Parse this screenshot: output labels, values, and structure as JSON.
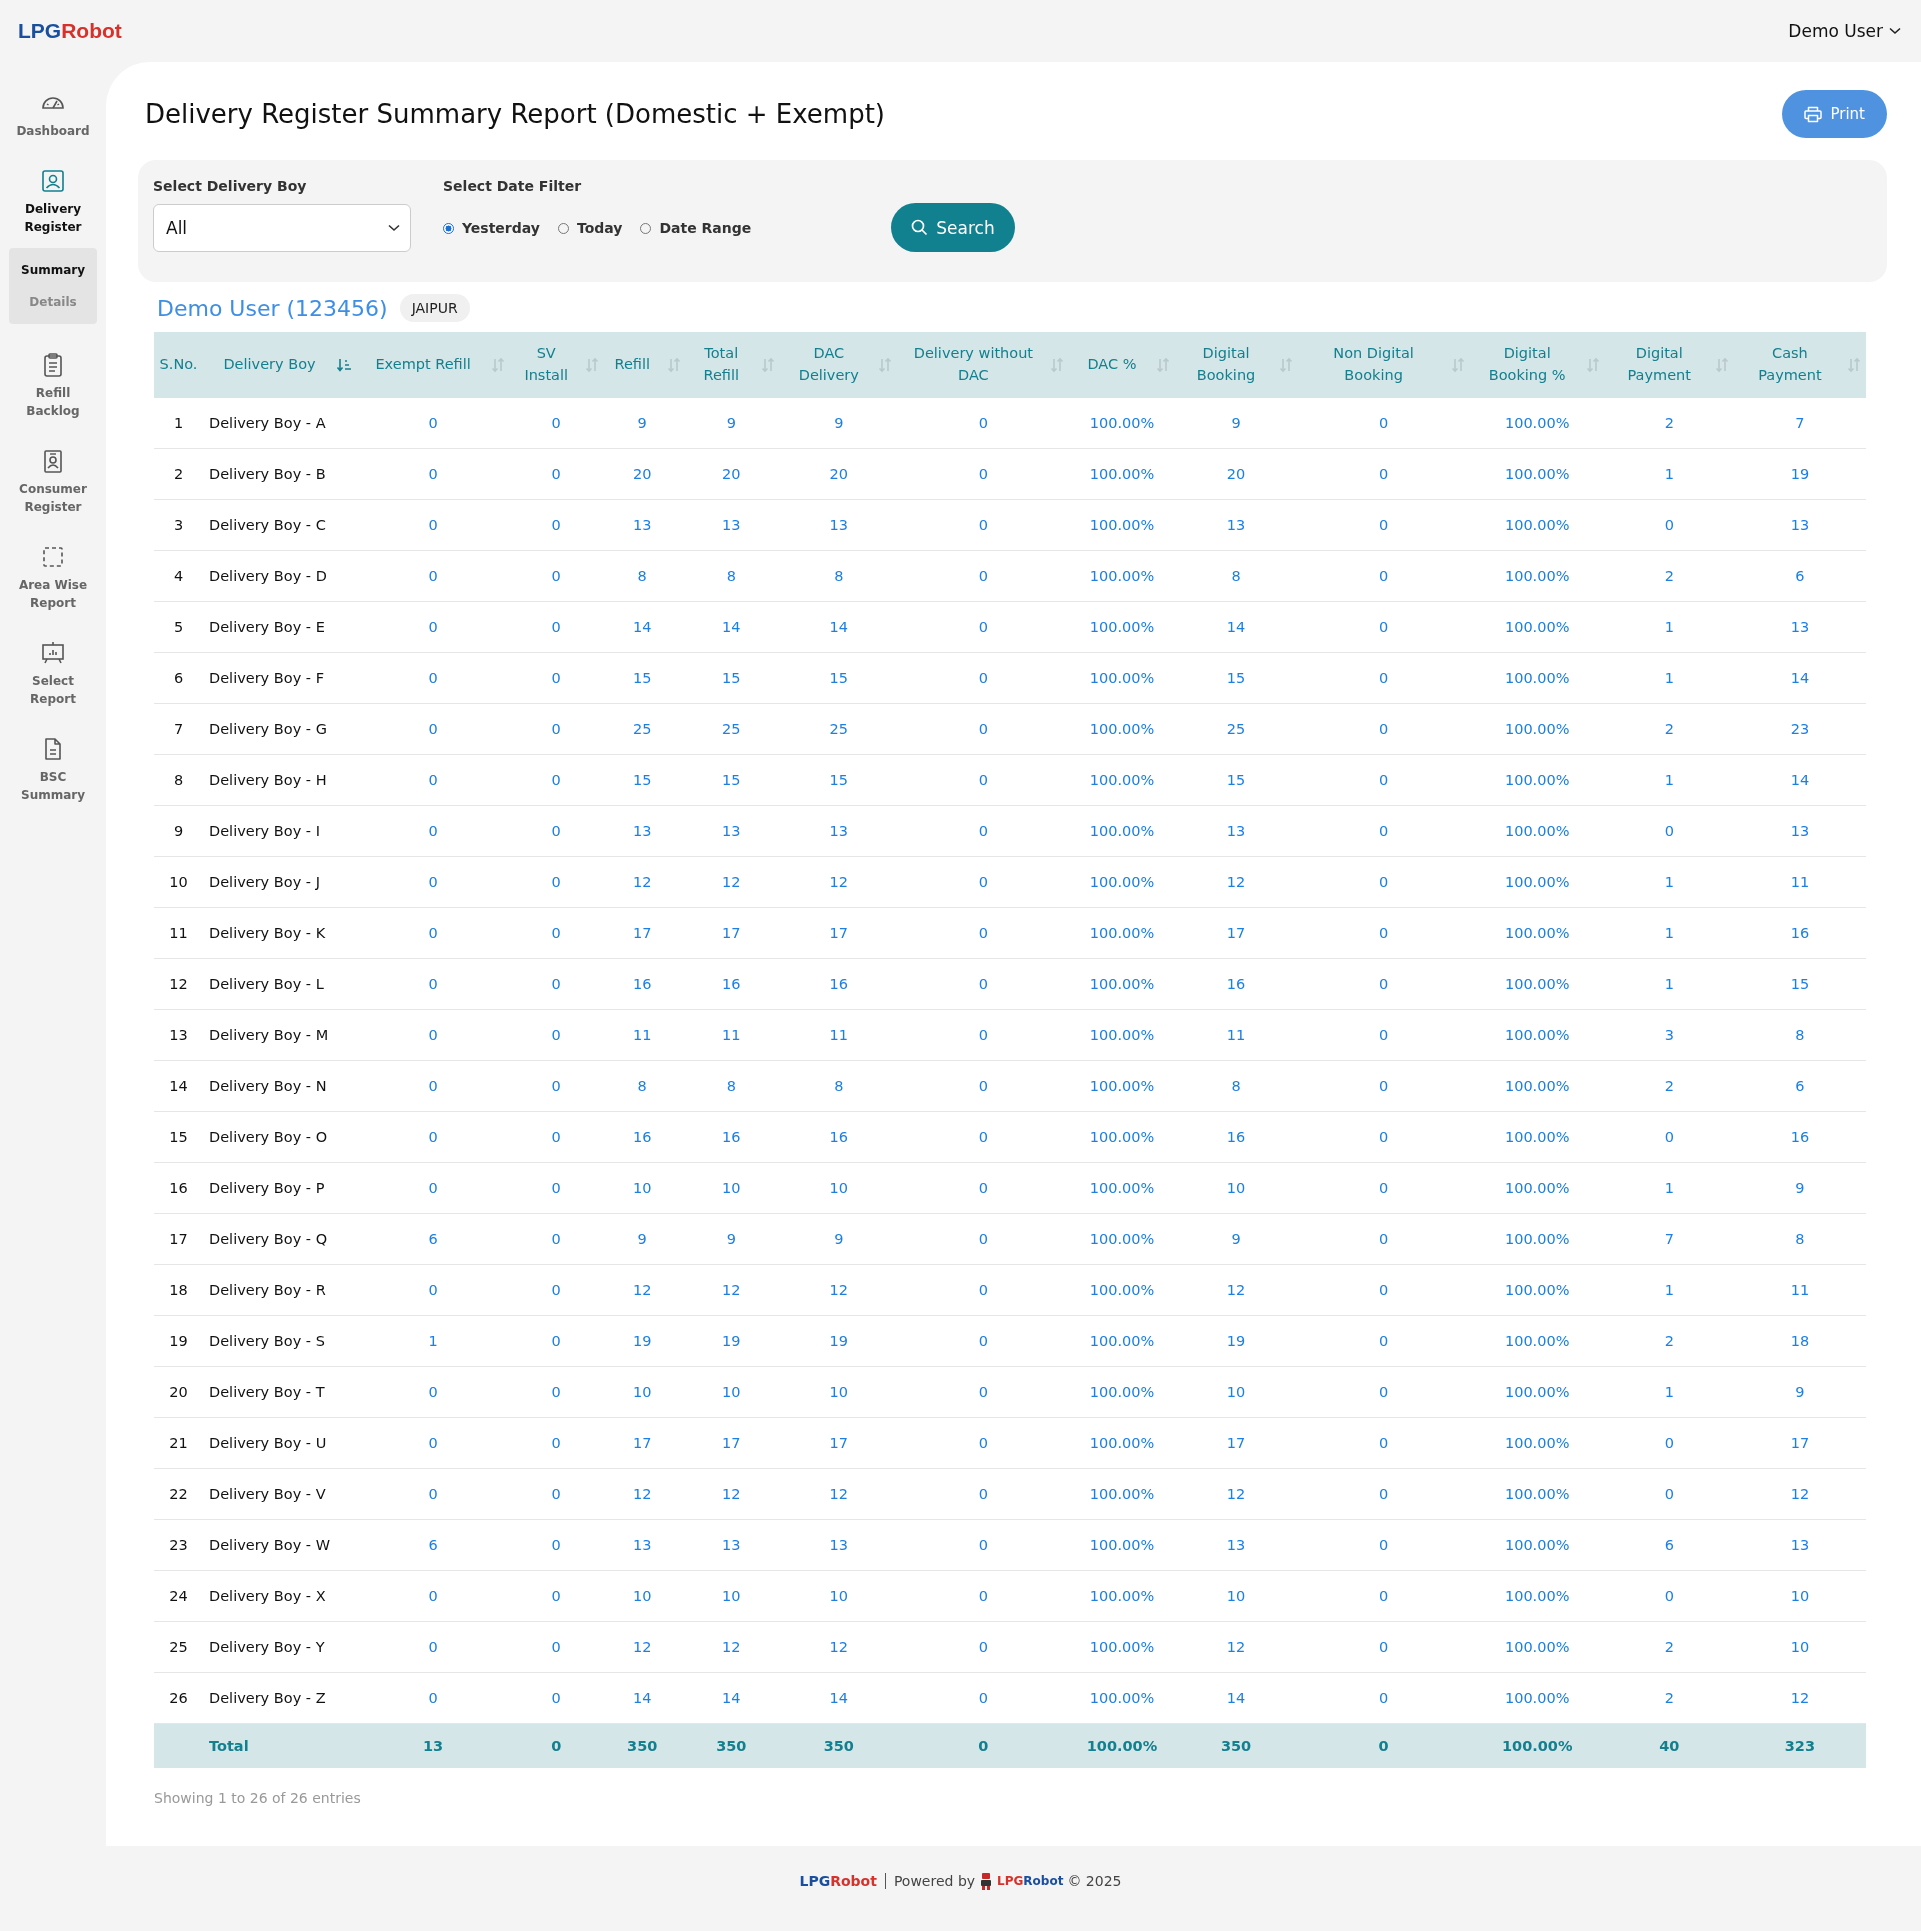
{
  "logo": {
    "part_1": "LPG",
    "part_2": "Robot"
  },
  "user_menu": {
    "label": "Demo User"
  },
  "sidebar": {
    "items": [
      {
        "label": "Dashboard",
        "selected": false
      },
      {
        "label": "Delivery Register",
        "selected": true,
        "children": [
          {
            "label": "Summary",
            "selected": true
          },
          {
            "label": "Details",
            "selected": false
          }
        ]
      },
      {
        "label": "Refill Backlog",
        "selected": false
      },
      {
        "label": "Consumer Register",
        "selected": false
      },
      {
        "label": "Area Wise Report",
        "selected": false
      },
      {
        "label": "Select Report",
        "selected": false
      },
      {
        "label": "BSC Summary",
        "selected": false
      }
    ]
  },
  "page": {
    "title": "Delivery Register Summary Report (Domestic + Exempt)",
    "print_button": "Print"
  },
  "filters": {
    "delivery_boy": {
      "label": "Select Delivery Boy",
      "value": "All"
    },
    "date_filter": {
      "label": "Select Date Filter",
      "options": [
        {
          "label": "Yesterday",
          "selected": true
        },
        {
          "label": "Today",
          "selected": false
        },
        {
          "label": "Date Range",
          "selected": false
        }
      ]
    },
    "search_button": "Search"
  },
  "agency": {
    "name": "Demo User (123456)",
    "city": "JAIPUR"
  },
  "table": {
    "columns": [
      {
        "label": "S.No.",
        "sortable": false
      },
      {
        "label": "Delivery Boy",
        "sortable": true,
        "sorted": true
      },
      {
        "label": "Exempt Refill",
        "sortable": true,
        "sorted": false
      },
      {
        "label": "SV Install",
        "sortable": true,
        "sorted": false
      },
      {
        "label": "Refill",
        "sortable": true,
        "sorted": false
      },
      {
        "label": "Total Refill",
        "sortable": true,
        "sorted": false
      },
      {
        "label": "DAC Delivery",
        "sortable": true,
        "sorted": false
      },
      {
        "label": "Delivery without DAC",
        "sortable": true,
        "sorted": false
      },
      {
        "label": "DAC %",
        "sortable": true,
        "sorted": false
      },
      {
        "label": "Digital Booking",
        "sortable": true,
        "sorted": false
      },
      {
        "label": "Non Digital Booking",
        "sortable": true,
        "sorted": false
      },
      {
        "label": "Digital Booking %",
        "sortable": true,
        "sorted": false
      },
      {
        "label": "Digital Payment",
        "sortable": true,
        "sorted": false
      },
      {
        "label": "Cash Payment",
        "sortable": true,
        "sorted": false
      }
    ],
    "rows": [
      [
        "1",
        "Delivery Boy - A",
        "0",
        "0",
        "9",
        "9",
        "9",
        "0",
        "100.00%",
        "9",
        "0",
        "100.00%",
        "2",
        "7"
      ],
      [
        "2",
        "Delivery Boy - B",
        "0",
        "0",
        "20",
        "20",
        "20",
        "0",
        "100.00%",
        "20",
        "0",
        "100.00%",
        "1",
        "19"
      ],
      [
        "3",
        "Delivery Boy - C",
        "0",
        "0",
        "13",
        "13",
        "13",
        "0",
        "100.00%",
        "13",
        "0",
        "100.00%",
        "0",
        "13"
      ],
      [
        "4",
        "Delivery Boy - D",
        "0",
        "0",
        "8",
        "8",
        "8",
        "0",
        "100.00%",
        "8",
        "0",
        "100.00%",
        "2",
        "6"
      ],
      [
        "5",
        "Delivery Boy - E",
        "0",
        "0",
        "14",
        "14",
        "14",
        "0",
        "100.00%",
        "14",
        "0",
        "100.00%",
        "1",
        "13"
      ],
      [
        "6",
        "Delivery Boy - F",
        "0",
        "0",
        "15",
        "15",
        "15",
        "0",
        "100.00%",
        "15",
        "0",
        "100.00%",
        "1",
        "14"
      ],
      [
        "7",
        "Delivery Boy - G",
        "0",
        "0",
        "25",
        "25",
        "25",
        "0",
        "100.00%",
        "25",
        "0",
        "100.00%",
        "2",
        "23"
      ],
      [
        "8",
        "Delivery Boy - H",
        "0",
        "0",
        "15",
        "15",
        "15",
        "0",
        "100.00%",
        "15",
        "0",
        "100.00%",
        "1",
        "14"
      ],
      [
        "9",
        "Delivery Boy - I",
        "0",
        "0",
        "13",
        "13",
        "13",
        "0",
        "100.00%",
        "13",
        "0",
        "100.00%",
        "0",
        "13"
      ],
      [
        "10",
        "Delivery Boy - J",
        "0",
        "0",
        "12",
        "12",
        "12",
        "0",
        "100.00%",
        "12",
        "0",
        "100.00%",
        "1",
        "11"
      ],
      [
        "11",
        "Delivery Boy - K",
        "0",
        "0",
        "17",
        "17",
        "17",
        "0",
        "100.00%",
        "17",
        "0",
        "100.00%",
        "1",
        "16"
      ],
      [
        "12",
        "Delivery Boy - L",
        "0",
        "0",
        "16",
        "16",
        "16",
        "0",
        "100.00%",
        "16",
        "0",
        "100.00%",
        "1",
        "15"
      ],
      [
        "13",
        "Delivery Boy - M",
        "0",
        "0",
        "11",
        "11",
        "11",
        "0",
        "100.00%",
        "11",
        "0",
        "100.00%",
        "3",
        "8"
      ],
      [
        "14",
        "Delivery Boy - N",
        "0",
        "0",
        "8",
        "8",
        "8",
        "0",
        "100.00%",
        "8",
        "0",
        "100.00%",
        "2",
        "6"
      ],
      [
        "15",
        "Delivery Boy - O",
        "0",
        "0",
        "16",
        "16",
        "16",
        "0",
        "100.00%",
        "16",
        "0",
        "100.00%",
        "0",
        "16"
      ],
      [
        "16",
        "Delivery Boy - P",
        "0",
        "0",
        "10",
        "10",
        "10",
        "0",
        "100.00%",
        "10",
        "0",
        "100.00%",
        "1",
        "9"
      ],
      [
        "17",
        "Delivery Boy - Q",
        "6",
        "0",
        "9",
        "9",
        "9",
        "0",
        "100.00%",
        "9",
        "0",
        "100.00%",
        "7",
        "8"
      ],
      [
        "18",
        "Delivery Boy - R",
        "0",
        "0",
        "12",
        "12",
        "12",
        "0",
        "100.00%",
        "12",
        "0",
        "100.00%",
        "1",
        "11"
      ],
      [
        "19",
        "Delivery Boy - S",
        "1",
        "0",
        "19",
        "19",
        "19",
        "0",
        "100.00%",
        "19",
        "0",
        "100.00%",
        "2",
        "18"
      ],
      [
        "20",
        "Delivery Boy - T",
        "0",
        "0",
        "10",
        "10",
        "10",
        "0",
        "100.00%",
        "10",
        "0",
        "100.00%",
        "1",
        "9"
      ],
      [
        "21",
        "Delivery Boy - U",
        "0",
        "0",
        "17",
        "17",
        "17",
        "0",
        "100.00%",
        "17",
        "0",
        "100.00%",
        "0",
        "17"
      ],
      [
        "22",
        "Delivery Boy - V",
        "0",
        "0",
        "12",
        "12",
        "12",
        "0",
        "100.00%",
        "12",
        "0",
        "100.00%",
        "0",
        "12"
      ],
      [
        "23",
        "Delivery Boy - W",
        "6",
        "0",
        "13",
        "13",
        "13",
        "0",
        "100.00%",
        "13",
        "0",
        "100.00%",
        "6",
        "13"
      ],
      [
        "24",
        "Delivery Boy - X",
        "0",
        "0",
        "10",
        "10",
        "10",
        "0",
        "100.00%",
        "10",
        "0",
        "100.00%",
        "0",
        "10"
      ],
      [
        "25",
        "Delivery Boy - Y",
        "0",
        "0",
        "12",
        "12",
        "12",
        "0",
        "100.00%",
        "12",
        "0",
        "100.00%",
        "2",
        "10"
      ],
      [
        "26",
        "Delivery Boy - Z",
        "0",
        "0",
        "14",
        "14",
        "14",
        "0",
        "100.00%",
        "14",
        "0",
        "100.00%",
        "2",
        "12"
      ]
    ],
    "total": [
      "Total",
      "13",
      "0",
      "350",
      "350",
      "350",
      "0",
      "100.00%",
      "350",
      "0",
      "100.00%",
      "40",
      "323"
    ],
    "info": "Showing 1 to 26 of 26 entries"
  },
  "footer": {
    "brand_1": {
      "part_1": "LPG",
      "part_2": "Robot"
    },
    "powered_by": "Powered by",
    "brand_2": {
      "part_1": "LPG",
      "part_2": "Robot"
    },
    "copyright": "© 2025"
  }
}
